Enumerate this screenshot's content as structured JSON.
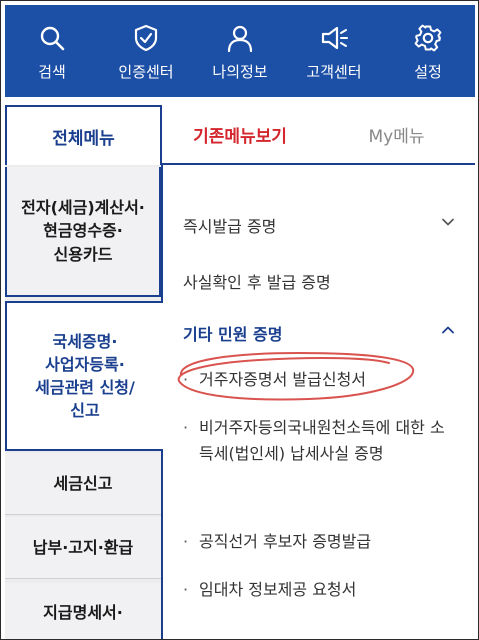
{
  "topnav": {
    "items": [
      {
        "label": "검색",
        "icon": "search-icon"
      },
      {
        "label": "인증센터",
        "icon": "shield-check-icon"
      },
      {
        "label": "나의정보",
        "icon": "person-icon"
      },
      {
        "label": "고객센터",
        "icon": "megaphone-icon"
      },
      {
        "label": "설정",
        "icon": "gear-icon"
      }
    ],
    "background": "#1c4fa6"
  },
  "tabs": [
    {
      "label": "전체메뉴",
      "active": true
    },
    {
      "label": "기존메뉴보기",
      "active": false
    },
    {
      "label": "My메뉴",
      "active": false
    }
  ],
  "categories": [
    {
      "label": "전자(세금)계산서·\n현금영수증·\n신용카드"
    },
    {
      "label": "국세증명·\n사업자등록·\n세금관련 신청/\n신고",
      "selected": true
    },
    {
      "label": "세금신고"
    },
    {
      "label": "납부·고지·환급"
    },
    {
      "label": "지급명세서·"
    }
  ],
  "menu": {
    "sections": [
      {
        "label": "즉시발급 증명",
        "expanded": false
      },
      {
        "label": "사실확인 후 발급 증명"
      },
      {
        "label": "기타 민원 증명",
        "expanded": true
      }
    ],
    "sub_items": [
      {
        "label": "거주자증명서 발급신청서"
      },
      {
        "label": "비거주자등의국내원천소득에 대한 소득세(법인세) 납세사실 증명"
      },
      {
        "label": "공직선거 후보자 증명발급"
      },
      {
        "label": "임대차 정보제공 요청서"
      }
    ]
  },
  "colors": {
    "accent": "#1a3f8f",
    "highlight_tab": "#d4262c",
    "annotation": "#d9534f"
  }
}
